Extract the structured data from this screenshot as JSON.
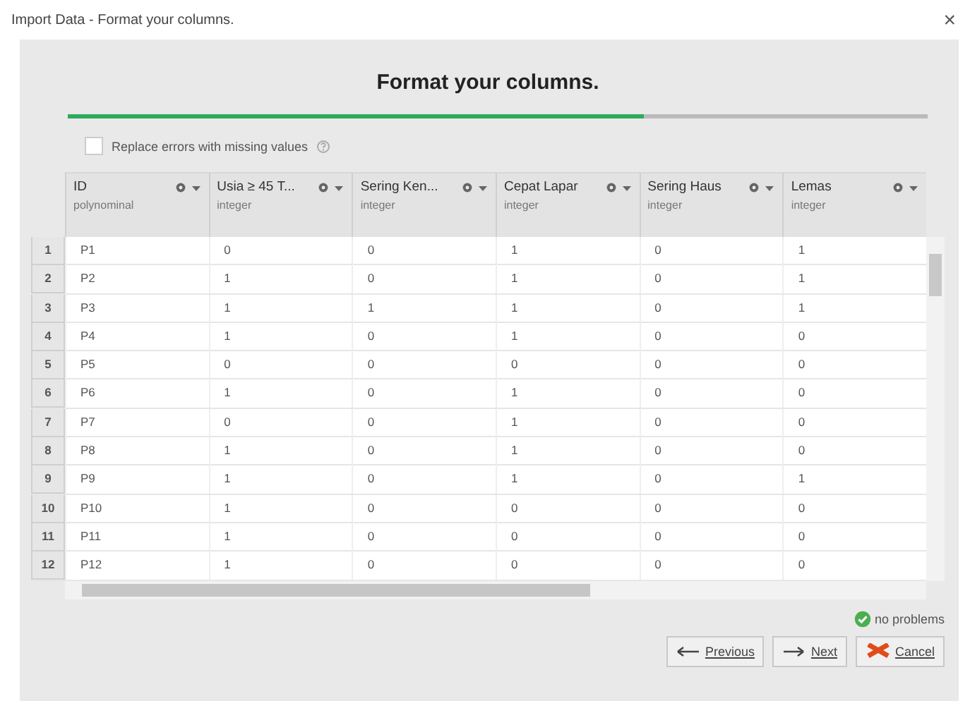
{
  "window": {
    "title": "Import Data - Format your columns.",
    "close": "×"
  },
  "heading": "Format your columns.",
  "progress": {
    "level": 0.67
  },
  "replace_errors": {
    "label": "Replace errors with missing values",
    "checked": false
  },
  "table": {
    "columns": [
      {
        "name": "ID",
        "type": "polynominal"
      },
      {
        "name": "Usia ≥ 45 T...",
        "type": "integer"
      },
      {
        "name": "Sering Ken...",
        "type": "integer"
      },
      {
        "name": "Cepat Lapar",
        "type": "integer"
      },
      {
        "name": "Sering Haus",
        "type": "integer"
      },
      {
        "name": "Lemas",
        "type": "integer"
      }
    ],
    "rows": [
      {
        "number": "1",
        "cells": [
          "P1",
          "0",
          "0",
          "1",
          "0",
          "1"
        ]
      },
      {
        "number": "2",
        "cells": [
          "P2",
          "1",
          "0",
          "1",
          "0",
          "1"
        ]
      },
      {
        "number": "3",
        "cells": [
          "P3",
          "1",
          "1",
          "1",
          "0",
          "1"
        ]
      },
      {
        "number": "4",
        "cells": [
          "P4",
          "1",
          "0",
          "1",
          "0",
          "0"
        ]
      },
      {
        "number": "5",
        "cells": [
          "P5",
          "0",
          "0",
          "0",
          "0",
          "0"
        ]
      },
      {
        "number": "6",
        "cells": [
          "P6",
          "1",
          "0",
          "1",
          "0",
          "0"
        ]
      },
      {
        "number": "7",
        "cells": [
          "P7",
          "0",
          "0",
          "1",
          "0",
          "0"
        ]
      },
      {
        "number": "8",
        "cells": [
          "P8",
          "1",
          "0",
          "1",
          "0",
          "0"
        ]
      },
      {
        "number": "9",
        "cells": [
          "P9",
          "1",
          "0",
          "1",
          "0",
          "1"
        ]
      },
      {
        "number": "10",
        "cells": [
          "P10",
          "1",
          "0",
          "0",
          "0",
          "0"
        ]
      },
      {
        "number": "11",
        "cells": [
          "P11",
          "1",
          "0",
          "0",
          "0",
          "0"
        ]
      },
      {
        "number": "12",
        "cells": [
          "P12",
          "1",
          "0",
          "0",
          "0",
          "0"
        ]
      }
    ]
  },
  "status": "no problems",
  "buttons": [
    {
      "label": "Previous",
      "kind": "previous"
    },
    {
      "label": "Next",
      "kind": "next"
    },
    {
      "label": "Cancel",
      "kind": "cancel"
    }
  ]
}
